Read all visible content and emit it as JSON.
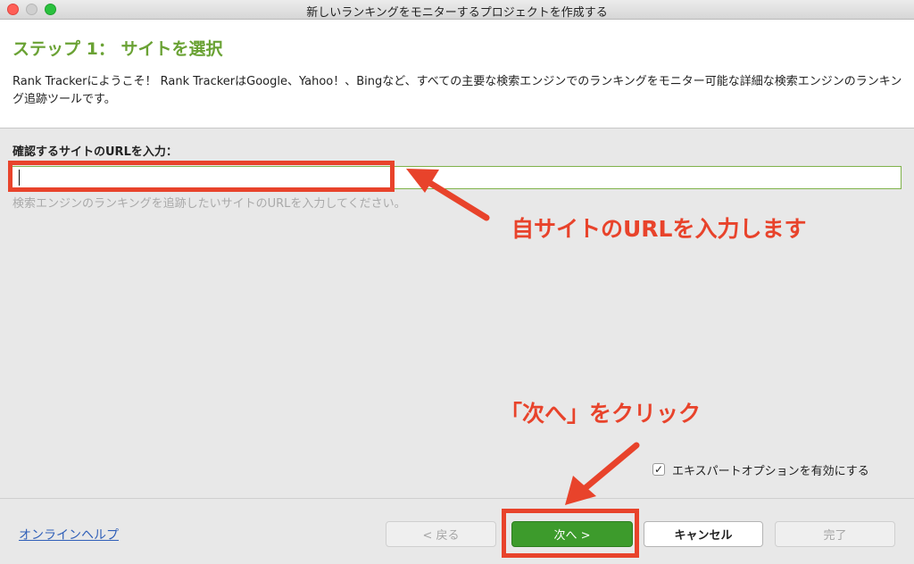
{
  "window": {
    "title": "新しいランキングをモニターするプロジェクトを作成する"
  },
  "header": {
    "step_title": "ステップ 1： サイトを選択",
    "intro": "Rank Trackerにようこそ！ Rank TrackerはGoogle、Yahoo！、Bingなど、すべての主要な検索エンジンでのランキングをモニター可能な詳細な検索エンジンのランキング追跡ツールです。"
  },
  "form": {
    "url_label": "確認するサイトのURLを入力：",
    "url_value": "",
    "url_placeholder": "",
    "hint": "検索エンジンのランキングを追跡したいサイトのURLを入力してください。"
  },
  "annotations": {
    "url_note": "自サイトのURLを入力します",
    "next_note": "「次へ」をクリック",
    "color": "#e8432b"
  },
  "options": {
    "expert_label": "エキスパートオプションを有効にする",
    "expert_checked": true,
    "check_glyph": "✓"
  },
  "footer": {
    "help_link": "オンラインヘルプ",
    "back_label": "< 戻る",
    "next_label": "次へ >",
    "cancel_label": "キャンセル",
    "finish_label": "完了"
  },
  "colors": {
    "accent_green": "#6aa234",
    "next_button": "#3d9b2c",
    "link": "#2f5fb8"
  }
}
